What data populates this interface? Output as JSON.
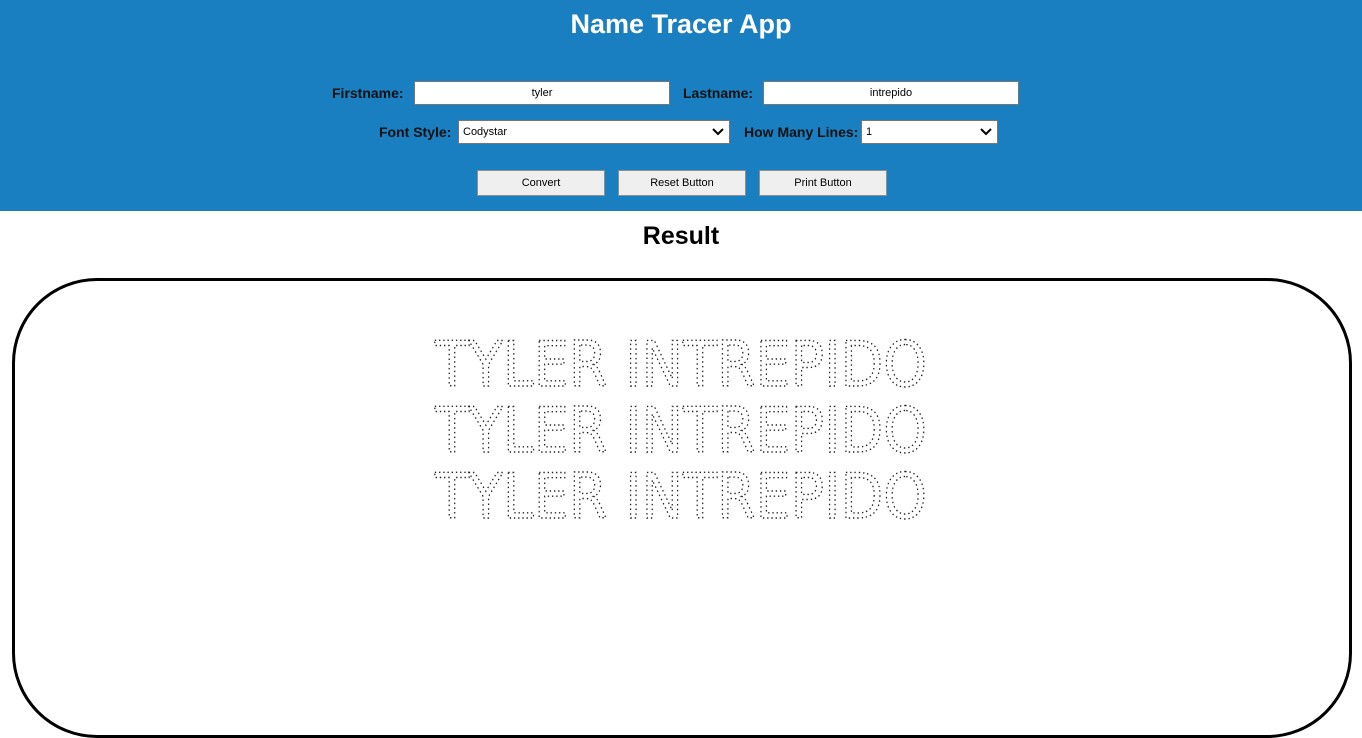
{
  "app": {
    "title": "Name Tracer App"
  },
  "form": {
    "firstname_label": "Firstname:",
    "firstname_value": "tyler",
    "lastname_label": "Lastname:",
    "lastname_value": "intrepido",
    "font_style_label": "Font Style:",
    "font_style_value": "Codystar",
    "lines_label": "How Many Lines:",
    "lines_value": "1"
  },
  "buttons": {
    "convert": "Convert",
    "reset": "Reset Button",
    "print": "Print Button"
  },
  "result": {
    "title": "Result",
    "lines": [
      "TYLER INTREPIDO",
      "TYLER INTREPIDO",
      "TYLER INTREPIDO"
    ]
  },
  "colors": {
    "header_bg": "#1a7fc1",
    "header_text": "#ffffff"
  }
}
